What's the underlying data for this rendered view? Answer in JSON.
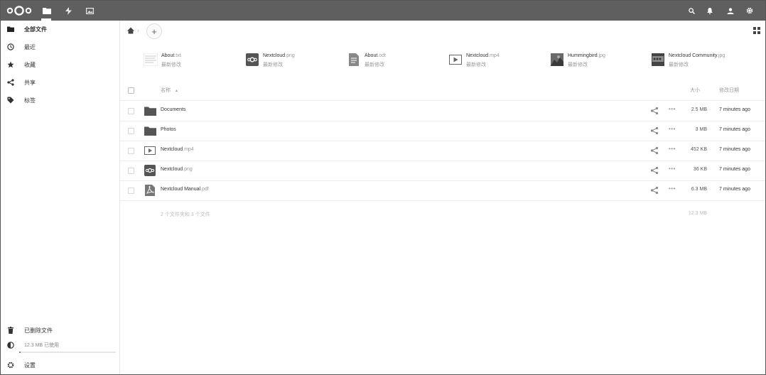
{
  "header": {
    "logo": "nextcloud-logo",
    "apps": [
      {
        "name": "files-icon",
        "active": true
      },
      {
        "name": "activity-icon"
      },
      {
        "name": "gallery-icon"
      }
    ],
    "right_icons": [
      "search-icon",
      "notifications-icon",
      "contacts-icon",
      "settings-icon"
    ]
  },
  "sidebar": {
    "items": [
      {
        "label": "全部文件",
        "icon": "folder-icon"
      },
      {
        "label": "最近",
        "icon": "clock-icon"
      },
      {
        "label": "收藏",
        "icon": "star-icon"
      },
      {
        "label": "共享",
        "icon": "share-icon"
      },
      {
        "label": "标签",
        "icon": "tag-icon"
      }
    ],
    "deleted_label": "已删除文件",
    "quota_label": "12.3 MB 已使用",
    "quota_fraction": 0.01,
    "settings_label": "设置"
  },
  "breadcrumb": {
    "add_label": "+"
  },
  "recent": [
    {
      "base": "About",
      "ext": ".txt",
      "sub": "最新修改",
      "icon": "text-thumb"
    },
    {
      "base": "Nextcloud",
      "ext": ".png",
      "sub": "最新修改",
      "icon": "nextcloud-thumb"
    },
    {
      "base": "About",
      "ext": ".odt",
      "sub": "最新修改",
      "icon": "document-icon"
    },
    {
      "base": "Nextcloud",
      "ext": ".mp4",
      "sub": "最新修改",
      "icon": "video-icon"
    },
    {
      "base": "Hummingbird",
      "ext": ".jpg",
      "sub": "最新修改",
      "icon": "photo-thumb"
    },
    {
      "base": "Nextcloud Community",
      "ext": ".jpg",
      "sub": "最新修改",
      "icon": "photo-thumb"
    }
  ],
  "table": {
    "col_name": "名称",
    "sort_indicator": "▲",
    "col_size": "大小",
    "col_modified": "修改日期",
    "rows": [
      {
        "base": "Documents",
        "ext": "",
        "size": "2.5 MB",
        "modified": "7 minutes ago",
        "type": "folder"
      },
      {
        "base": "Photos",
        "ext": "",
        "size": "3 MB",
        "modified": "7 minutes ago",
        "type": "folder"
      },
      {
        "base": "Nextcloud",
        "ext": ".mp4",
        "size": "452 KB",
        "modified": "7 minutes ago",
        "type": "video"
      },
      {
        "base": "Nextcloud",
        "ext": ".png",
        "size": "36 KB",
        "modified": "7 minutes ago",
        "type": "image"
      },
      {
        "base": "Nextcloud Manual",
        "ext": ".pdf",
        "size": "6.3 MB",
        "modified": "7 minutes ago",
        "type": "pdf"
      }
    ],
    "more_label": "•••",
    "summary_text": "2 个文件夹和 3 个文件",
    "summary_size": "12.3 MB"
  }
}
